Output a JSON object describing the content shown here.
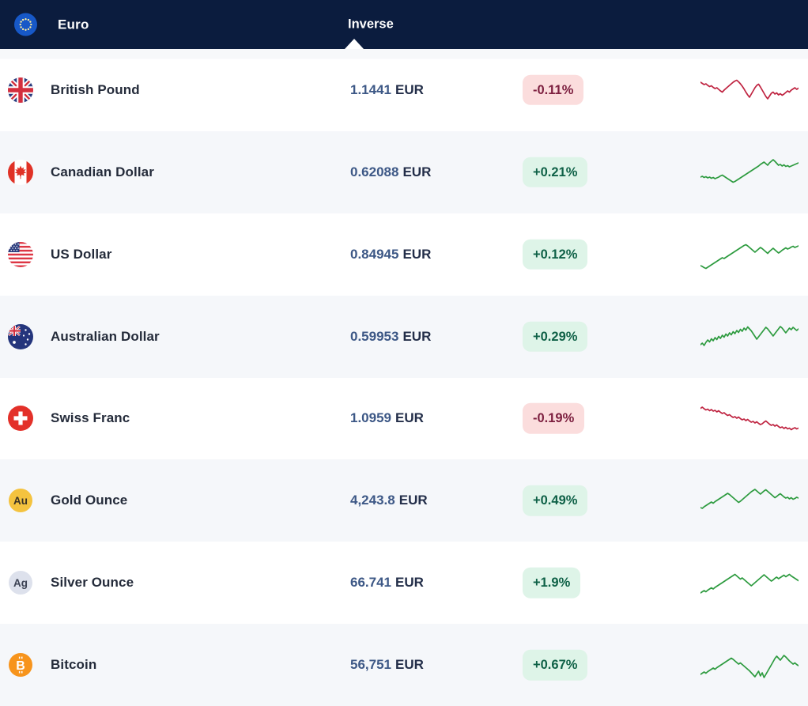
{
  "header": {
    "base_currency": "Euro",
    "base_flag_icon": "flag-eu-icon",
    "column_label": "Inverse"
  },
  "colors": {
    "header_bg": "#0b1c3e",
    "row_alt_bg": "#f5f7fa",
    "up_badge_bg": "#def4e8",
    "up_badge_text": "#0f6147",
    "down_badge_bg": "#fbdddd",
    "down_badge_text": "#7d2040",
    "spark_up": "#2d9b3f",
    "spark_down": "#bf2340"
  },
  "rows": [
    {
      "name": "British Pound",
      "icon": "flag-gb",
      "rate": "1.1441",
      "unit": "EUR",
      "change": "-0.11%",
      "direction": "down",
      "spark": [
        30,
        33,
        36,
        34,
        38,
        41,
        39,
        43,
        46,
        44,
        48,
        52,
        55,
        50,
        46,
        42,
        38,
        34,
        30,
        27,
        25,
        29,
        34,
        40,
        47,
        55,
        62,
        68,
        60,
        52,
        44,
        38,
        35,
        42,
        50,
        58,
        66,
        72,
        65,
        58,
        55,
        60,
        57,
        62,
        59,
        63,
        60,
        56,
        52,
        55,
        50,
        47,
        44,
        48,
        45
      ]
    },
    {
      "name": "Canadian Dollar",
      "icon": "flag-ca",
      "rate": "0.62088",
      "unit": "EUR",
      "change": "+0.21%",
      "direction": "up",
      "spark": [
        62,
        60,
        63,
        61,
        64,
        62,
        65,
        63,
        66,
        64,
        62,
        59,
        57,
        60,
        63,
        66,
        69,
        72,
        75,
        73,
        70,
        67,
        64,
        61,
        58,
        55,
        52,
        49,
        46,
        43,
        40,
        37,
        34,
        30,
        27,
        24,
        28,
        32,
        26,
        22,
        18,
        22,
        27,
        32,
        30,
        34,
        31,
        35,
        33,
        36,
        34,
        32,
        30,
        28,
        26
      ]
    },
    {
      "name": "US Dollar",
      "icon": "flag-us",
      "rate": "0.84945",
      "unit": "EUR",
      "change": "+0.12%",
      "direction": "up",
      "spark": [
        78,
        80,
        83,
        85,
        82,
        79,
        76,
        73,
        70,
        67,
        64,
        61,
        58,
        60,
        57,
        54,
        51,
        48,
        45,
        42,
        39,
        36,
        33,
        30,
        27,
        25,
        28,
        32,
        36,
        40,
        44,
        40,
        36,
        32,
        35,
        39,
        43,
        47,
        42,
        38,
        34,
        38,
        42,
        46,
        43,
        39,
        36,
        33,
        36,
        34,
        31,
        29,
        32,
        30,
        28
      ]
    },
    {
      "name": "Australian Dollar",
      "icon": "flag-au",
      "rate": "0.59953",
      "unit": "EUR",
      "change": "+0.29%",
      "direction": "up",
      "spark": [
        70,
        66,
        72,
        64,
        58,
        63,
        55,
        60,
        52,
        57,
        49,
        54,
        46,
        51,
        43,
        48,
        40,
        45,
        37,
        42,
        34,
        39,
        31,
        36,
        28,
        33,
        25,
        30,
        35,
        42,
        49,
        56,
        50,
        44,
        38,
        32,
        26,
        30,
        36,
        42,
        48,
        42,
        36,
        30,
        24,
        28,
        34,
        40,
        34,
        28,
        32,
        26,
        30,
        34,
        30
      ]
    },
    {
      "name": "Swiss Franc",
      "icon": "flag-ch",
      "rate": "1.0959",
      "unit": "EUR",
      "change": "-0.19%",
      "direction": "down",
      "spark": [
        25,
        22,
        26,
        29,
        27,
        31,
        28,
        32,
        30,
        34,
        31,
        35,
        38,
        36,
        40,
        43,
        41,
        45,
        48,
        46,
        50,
        47,
        51,
        54,
        52,
        56,
        53,
        57,
        60,
        58,
        62,
        59,
        63,
        66,
        64,
        60,
        57,
        61,
        65,
        68,
        66,
        70,
        67,
        71,
        74,
        72,
        76,
        73,
        77,
        75,
        79,
        76,
        74,
        77,
        75
      ]
    },
    {
      "name": "Gold Ounce",
      "icon": "metal-gold",
      "rate": "4,243.8",
      "unit": "EUR",
      "change": "+0.49%",
      "direction": "up",
      "spark": [
        68,
        70,
        66,
        63,
        60,
        57,
        54,
        57,
        53,
        50,
        47,
        44,
        41,
        38,
        35,
        32,
        35,
        39,
        43,
        47,
        51,
        55,
        52,
        48,
        44,
        40,
        36,
        32,
        28,
        25,
        22,
        26,
        30,
        34,
        30,
        26,
        23,
        27,
        31,
        35,
        39,
        43,
        40,
        36,
        33,
        37,
        41,
        44,
        42,
        46,
        43,
        47,
        45,
        42,
        44
      ]
    },
    {
      "name": "Silver Ounce",
      "icon": "metal-silver",
      "rate": "66.741",
      "unit": "EUR",
      "change": "+1.9%",
      "direction": "up",
      "spark": [
        76,
        73,
        70,
        73,
        69,
        66,
        63,
        66,
        62,
        59,
        56,
        53,
        50,
        47,
        44,
        41,
        38,
        35,
        32,
        29,
        33,
        37,
        41,
        38,
        42,
        46,
        50,
        54,
        58,
        54,
        50,
        46,
        42,
        38,
        34,
        30,
        34,
        38,
        42,
        46,
        43,
        39,
        36,
        40,
        37,
        34,
        31,
        35,
        32,
        29,
        33,
        36,
        39,
        42,
        45
      ]
    },
    {
      "name": "Bitcoin",
      "icon": "crypto-btc",
      "rate": "56,751",
      "unit": "EUR",
      "change": "+0.67%",
      "direction": "up",
      "spark": [
        74,
        71,
        68,
        71,
        67,
        64,
        61,
        58,
        61,
        57,
        54,
        51,
        48,
        45,
        42,
        39,
        36,
        33,
        36,
        40,
        44,
        48,
        45,
        49,
        53,
        57,
        61,
        65,
        70,
        75,
        80,
        73,
        66,
        78,
        70,
        82,
        74,
        66,
        58,
        50,
        42,
        34,
        28,
        33,
        38,
        32,
        26,
        30,
        35,
        40,
        44,
        48,
        45,
        49,
        52
      ]
    }
  ]
}
